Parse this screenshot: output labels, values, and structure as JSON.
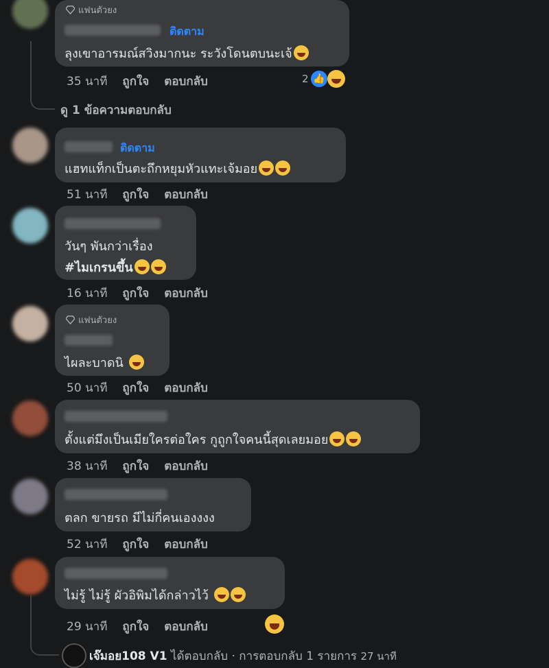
{
  "comments": [
    {
      "fan_badge": "แฟนตัวยง",
      "follow_label": "ติดตาม",
      "text": "ลุงเขาอารมณ์สวิงมากนะ ระวังโดนตบนะเจ้",
      "time": "35 นาที",
      "like": "ถูกใจ",
      "reply": "ตอบกลับ",
      "reaction_count": "2",
      "view_replies": "ดู 1 ข้อความตอบกลับ",
      "avatar_color": "#6a7a5a"
    },
    {
      "follow_label": "ติดตาม",
      "text": "แฮทแท็กเป็นตะถึกหยุมหัวแทะเจ้มอย",
      "time": "51 นาที",
      "like": "ถูกใจ",
      "reply": "ตอบกลับ",
      "avatar_color": "#b9a496"
    },
    {
      "text_line1": "วันๆ พันกว่าเรื่อง",
      "text_line2": "#ไมเกรนขึ้น",
      "time": "16 นาที",
      "like": "ถูกใจ",
      "reply": "ตอบกลับ",
      "avatar_color": "#8ec7d4"
    },
    {
      "fan_badge": "แฟนตัวยง",
      "text": "ไผละบาดนิ",
      "time": "50 นาที",
      "like": "ถูกใจ",
      "reply": "ตอบกลับ",
      "avatar_color": "#d8c2b0"
    },
    {
      "text": "ตั้งแต่มึงเป็นเมียใครต่อใคร กูถูกใจคนนี้สุดเลยมอย",
      "time": "38 นาที",
      "like": "ถูกใจ",
      "reply": "ตอบกลับ",
      "avatar_color": "#a0533f"
    },
    {
      "text": "ตลก ขายรถ มีไม่กี่คนเองงงง",
      "time": "52 นาที",
      "like": "ถูกใจ",
      "reply": "ตอบกลับ",
      "avatar_color": "#8a8594"
    },
    {
      "text": "ไม่รู้ ไม่รู้ ผัวอิพิมได้กล่าวไว้",
      "time": "29 นาที",
      "like": "ถูกใจ",
      "reply": "ตอบกลับ",
      "avatar_color": "#b5502f"
    }
  ],
  "reply_summary": {
    "author": "เจ๊มอย108 V1",
    "action": "ได้ตอบกลับ · การตอบกลับ 1 รายการ",
    "time": "27 นาที"
  },
  "colors": {
    "background": "#18191a",
    "bubble": "#3a3b3c",
    "link": "#2d88ff",
    "meta": "#b0b3b8"
  }
}
